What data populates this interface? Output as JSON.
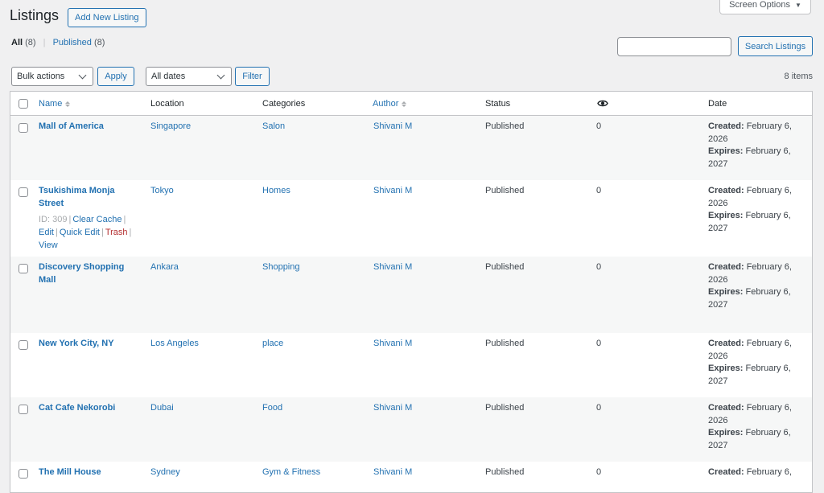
{
  "screen_options": {
    "label": "Screen Options",
    "arrow": "▼"
  },
  "header": {
    "title": "Listings",
    "add_new_label": "Add New Listing"
  },
  "views": {
    "all_label": "All",
    "all_count": "(8)",
    "separator": "|",
    "published_label": "Published",
    "published_count": "(8)"
  },
  "search": {
    "placeholder": "",
    "button_label": "Search Listings"
  },
  "toolbar": {
    "bulk_selected": "Bulk actions",
    "apply_label": "Apply",
    "dates_selected": "All dates",
    "filter_label": "Filter",
    "items_count": "8 items"
  },
  "columns": {
    "name": "Name",
    "location": "Location",
    "categories": "Categories",
    "author": "Author",
    "status": "Status",
    "views_icon": "eye-icon",
    "date": "Date"
  },
  "rows": [
    {
      "name": "Mall of America",
      "location": "Singapore",
      "category": "Salon",
      "author": "Shivani M",
      "status": "Published",
      "views": "0",
      "created_label": "Created:",
      "created": "February 6, 2026",
      "expires_label": "Expires:",
      "expires": "February 6, 2027"
    },
    {
      "name": "Tsukishima Monja Street",
      "location": "Tokyo",
      "category": "Homes",
      "author": "Shivani M",
      "status": "Published",
      "views": "0",
      "created_label": "Created:",
      "created": "February 6, 2026",
      "expires_label": "Expires:",
      "expires": "February 6, 2027",
      "actions": {
        "id": "ID: 309",
        "clear_cache": "Clear Cache",
        "edit": "Edit",
        "quick_edit": "Quick Edit",
        "trash": "Trash",
        "view": "View",
        "sep": "|"
      }
    },
    {
      "name": "Discovery Shopping Mall",
      "location": "Ankara",
      "category": "Shopping",
      "author": "Shivani M",
      "status": "Published",
      "views": "0",
      "created_label": "Created:",
      "created": "February 6, 2026",
      "expires_label": "Expires:",
      "expires": "February 6, 2027"
    },
    {
      "name": "New York City, NY",
      "location": "Los Angeles",
      "category": "place",
      "author": "Shivani M",
      "status": "Published",
      "views": "0",
      "created_label": "Created:",
      "created": "February 6, 2026",
      "expires_label": "Expires:",
      "expires": "February 6, 2027"
    },
    {
      "name": "Cat Cafe Nekorobi",
      "location": "Dubai",
      "category": "Food",
      "author": "Shivani M",
      "status": "Published",
      "views": "0",
      "created_label": "Created:",
      "created": "February 6, 2026",
      "expires_label": "Expires:",
      "expires": "February 6, 2027"
    },
    {
      "name": "The Mill House",
      "location": "Sydney",
      "category": "Gym & Fitness",
      "author": "Shivani M",
      "status": "Published",
      "views": "0",
      "created_label": "Created:",
      "created": "February 6,",
      "expires_label": "",
      "expires": ""
    }
  ]
}
